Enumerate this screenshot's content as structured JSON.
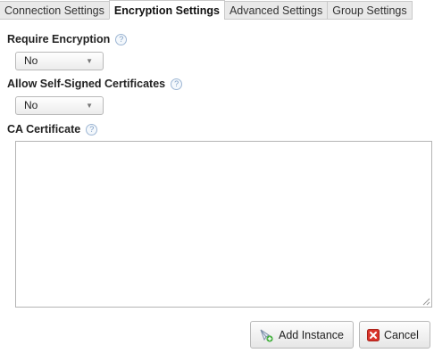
{
  "tabs": [
    {
      "label": "Connection Settings",
      "active": false
    },
    {
      "label": "Encryption Settings",
      "active": true
    },
    {
      "label": "Advanced Settings",
      "active": false
    },
    {
      "label": "Group Settings",
      "active": false
    }
  ],
  "fields": {
    "require_encryption": {
      "label": "Require Encryption",
      "value": "No"
    },
    "allow_self_signed": {
      "label": "Allow Self-Signed Certificates",
      "value": "No"
    },
    "ca_certificate": {
      "label": "CA Certificate",
      "value": ""
    }
  },
  "help_glyph": "?",
  "buttons": {
    "add_instance": {
      "label": "Add Instance",
      "icon": "add-instance-icon"
    },
    "cancel": {
      "label": "Cancel",
      "icon": "cancel-x-icon"
    }
  },
  "colors": {
    "cancel_icon": "#d9342b",
    "add_icon_plus": "#3fae3a",
    "help_icon": "#7a9cc4"
  }
}
